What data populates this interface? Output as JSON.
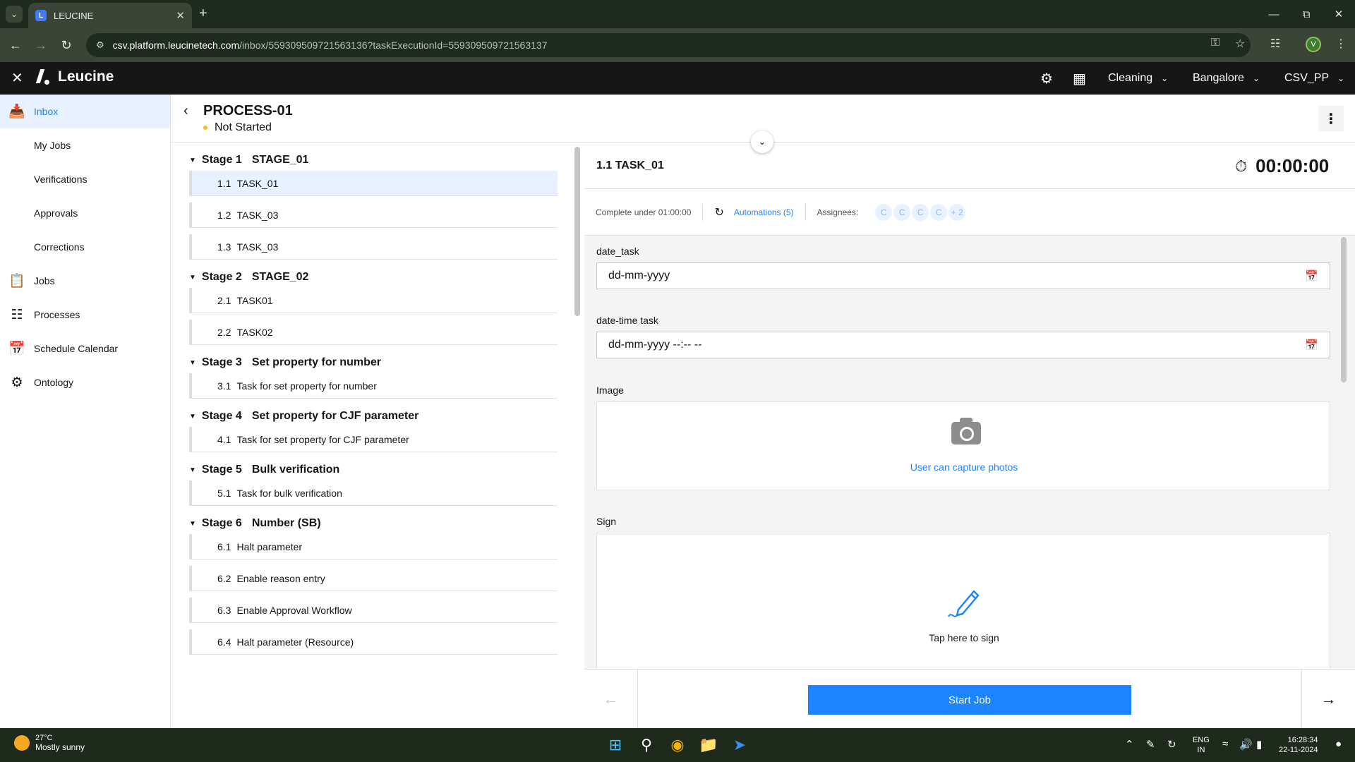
{
  "browser": {
    "tab_title": "LEUCINE",
    "url_host": "csv.platform.leucinetech.com",
    "url_path": "/inbox/559309509721563136?taskExecutionId=559309509721563137",
    "profile_initial": "V"
  },
  "header": {
    "brand": "Leucine",
    "use_case": "Cleaning",
    "facility": "Bangalore",
    "organization": "CSV_PP"
  },
  "sidebar": {
    "items": [
      {
        "label": "Inbox",
        "icon": "inbox-icon"
      },
      {
        "label": "My Jobs"
      },
      {
        "label": "Verifications"
      },
      {
        "label": "Approvals"
      },
      {
        "label": "Corrections"
      },
      {
        "label": "Jobs",
        "icon": "clipboard-icon"
      },
      {
        "label": "Processes",
        "icon": "flowchart-icon"
      },
      {
        "label": "Schedule Calendar",
        "icon": "calendar-icon"
      },
      {
        "label": "Ontology",
        "icon": "hierarchy-icon"
      }
    ]
  },
  "process": {
    "name": "PROCESS-01",
    "status": "Not Started"
  },
  "stages": [
    {
      "label": "Stage 1",
      "name": "STAGE_01",
      "tasks": [
        {
          "num": "1.1",
          "name": "TASK_01"
        },
        {
          "num": "1.2",
          "name": "TASK_03"
        },
        {
          "num": "1.3",
          "name": "TASK_03"
        }
      ]
    },
    {
      "label": "Stage 2",
      "name": "STAGE_02",
      "tasks": [
        {
          "num": "2.1",
          "name": "TASK01"
        },
        {
          "num": "2.2",
          "name": "TASK02"
        }
      ]
    },
    {
      "label": "Stage 3",
      "name": "Set property for number",
      "tasks": [
        {
          "num": "3.1",
          "name": "Task for set property for number"
        }
      ]
    },
    {
      "label": "Stage 4",
      "name": "Set property for CJF parameter",
      "tasks": [
        {
          "num": "4.1",
          "name": "Task for set property for CJF parameter"
        }
      ]
    },
    {
      "label": "Stage 5",
      "name": "Bulk verification",
      "tasks": [
        {
          "num": "5.1",
          "name": "Task for bulk verification"
        }
      ]
    },
    {
      "label": "Stage 6",
      "name": "Number (SB)",
      "tasks": [
        {
          "num": "6.1",
          "name": "Halt parameter"
        },
        {
          "num": "6.2",
          "name": "Enable reason entry"
        },
        {
          "num": "6.3",
          "name": "Enable Approval Workflow"
        },
        {
          "num": "6.4",
          "name": "Halt parameter (Resource)"
        }
      ]
    }
  ],
  "task": {
    "title": "1.1 TASK_01",
    "timer": "00:00:00",
    "complete_under": "Complete under 01:00:00",
    "automations": "Automations (5)",
    "assignees_label": "Assignees:",
    "assignees": [
      "C",
      "C",
      "C",
      "C",
      "+ 2"
    ],
    "fields": {
      "date_label": "date_task",
      "date_placeholder": "dd-mm-yyyy",
      "datetime_label": "date-time task",
      "datetime_placeholder": "dd-mm-yyyy --:-- --",
      "image_label": "Image",
      "image_hint": "User can capture photos",
      "sign_label": "Sign",
      "sign_hint": "Tap here to sign"
    }
  },
  "footer": {
    "start_label": "Start Job"
  },
  "taskbar": {
    "temperature": "27°C",
    "weather": "Mostly sunny",
    "lang_top": "ENG",
    "lang_bottom": "IN",
    "time": "16:28:34",
    "date": "22-11-2024"
  },
  "colors": {
    "accent": "#1d84ff",
    "status_not_started": "#f1c21b",
    "header_bg": "#161616"
  }
}
